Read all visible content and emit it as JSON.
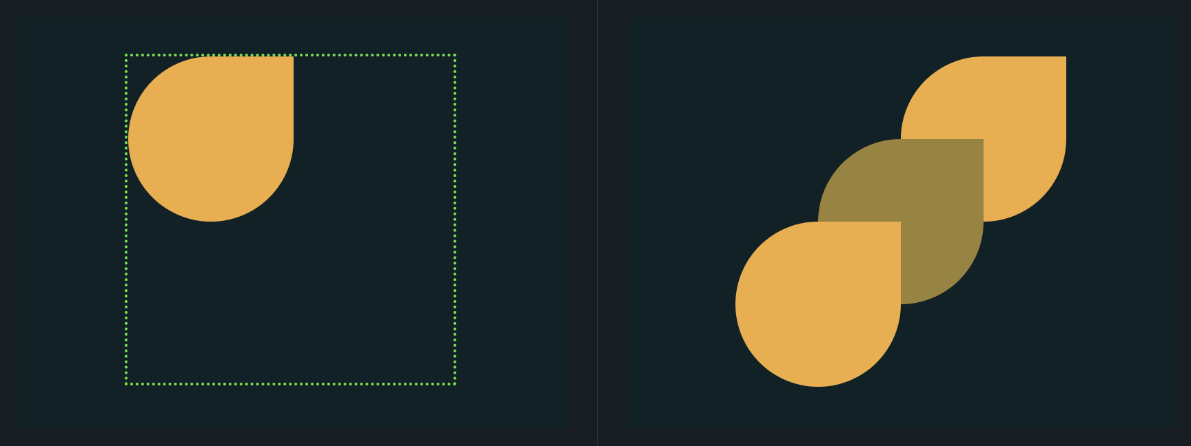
{
  "colors": {
    "page_background": "#181d22",
    "panel_background": "#122126",
    "divider": "#3a3f46",
    "frame_border": "#7de04f",
    "shape_primary": "#e8ae52",
    "shape_overlap": "#978342"
  },
  "left_panel": {
    "shape": {
      "kind": "teardrop",
      "color": "#e8ae52"
    }
  },
  "right_panel": {
    "shapes": [
      {
        "kind": "teardrop",
        "color": "#e8ae52"
      },
      {
        "kind": "teardrop",
        "color": "#978342"
      },
      {
        "kind": "teardrop",
        "color": "#e8ae52"
      }
    ]
  }
}
